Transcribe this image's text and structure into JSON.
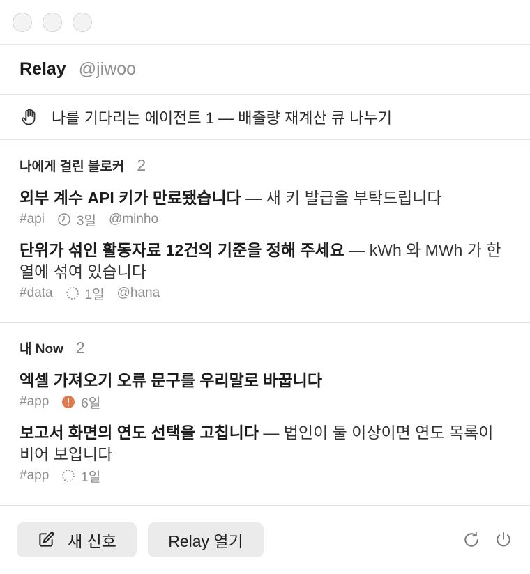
{
  "header": {
    "app_name": "Relay",
    "handle": "@jiwoo"
  },
  "waiting_on_me": {
    "icon": "hand-icon",
    "text": "나를 기다리는 에이전트 1 — 배출량 재계산 큐 나누기"
  },
  "blockers": {
    "title": "나에게 걸린 블로커",
    "count": "2",
    "items": [
      {
        "title": "외부 계수 API 키가 만료됐습니다",
        "detail": " — 새 키 발급을 부탁드립니다",
        "tag": "#api",
        "status_icon": "clock-icon",
        "age": "3일",
        "owner": "@minho"
      },
      {
        "title": "단위가 섞인 활동자료 12건의 기준을 정해 주세요",
        "detail": " — kWh 와 MWh 가 한 열에 섞여 있습니다",
        "tag": "#data",
        "status_icon": "dotted-circle-icon",
        "age": "1일",
        "owner": "@hana"
      }
    ]
  },
  "now": {
    "title": "내 Now",
    "count": "2",
    "items": [
      {
        "title": "엑셀 가져오기 오류 문구를 우리말로 바꿉니다",
        "detail": "",
        "tag": "#app",
        "status_icon": "alert-icon",
        "status_color": "#e07a4e",
        "age": "6일"
      },
      {
        "title": "보고서 화면의 연도 선택을 고칩니다",
        "detail": " — 법인이 둘 이상이면 연도 목록이 비어 보입니다",
        "tag": "#app",
        "status_icon": "dotted-circle-icon",
        "age": "1일"
      }
    ]
  },
  "footer": {
    "new_signal_label": "새 신호",
    "open_relay_label": "Relay 열기",
    "refresh_icon": "refresh-icon",
    "power_icon": "power-icon"
  }
}
